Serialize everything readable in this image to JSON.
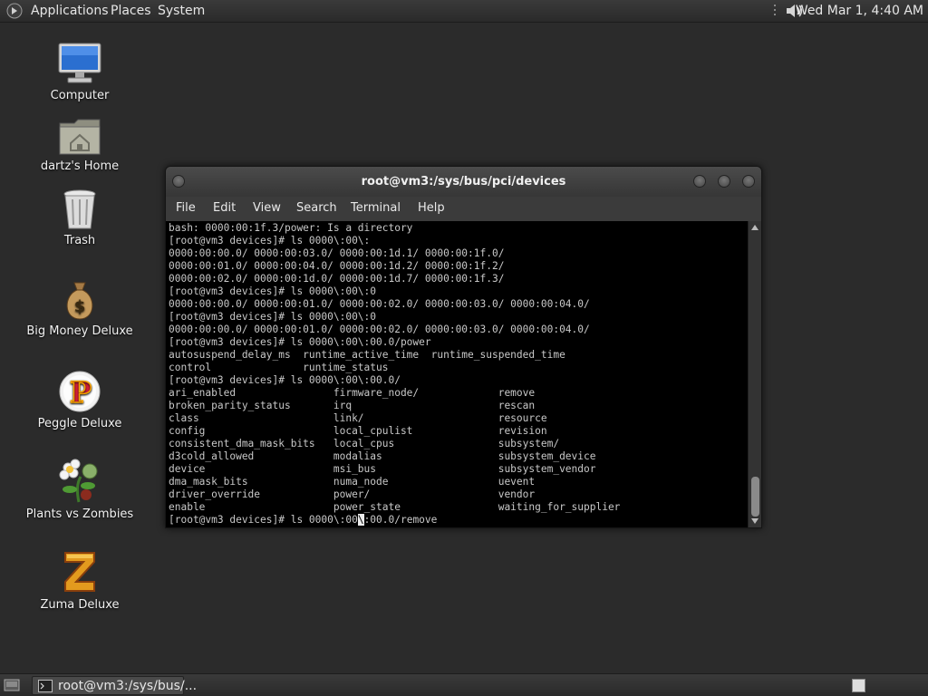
{
  "top_panel": {
    "menus": [
      "Applications",
      "Places",
      "System"
    ],
    "clock": "Wed Mar 1,  4:40 AM"
  },
  "desktop": {
    "icons": [
      {
        "label": "Computer",
        "icon": "computer-icon"
      },
      {
        "label": "dartz's Home",
        "icon": "home-folder-icon"
      },
      {
        "label": "Trash",
        "icon": "trash-icon"
      },
      {
        "label": "Big Money Deluxe",
        "icon": "money-bag-icon"
      },
      {
        "label": "Peggle Deluxe",
        "icon": "peggle-icon"
      },
      {
        "label": "Plants vs Zombies",
        "icon": "plants-vs-zombies-icon"
      },
      {
        "label": "Zuma Deluxe",
        "icon": "zuma-icon"
      }
    ]
  },
  "terminal": {
    "title": "root@vm3:/sys/bus/pci/devices",
    "menu": [
      "File",
      "Edit",
      "View",
      "Search",
      "Terminal",
      "Help"
    ],
    "lines": [
      "bash: 0000:00:1f.3/power: Is a directory",
      "[root@vm3 devices]# ls 0000\\:00\\:",
      "0000:00:00.0/ 0000:00:03.0/ 0000:00:1d.1/ 0000:00:1f.0/",
      "0000:00:01.0/ 0000:00:04.0/ 0000:00:1d.2/ 0000:00:1f.2/",
      "0000:00:02.0/ 0000:00:1d.0/ 0000:00:1d.7/ 0000:00:1f.3/",
      "[root@vm3 devices]# ls 0000\\:00\\:0",
      "0000:00:00.0/ 0000:00:01.0/ 0000:00:02.0/ 0000:00:03.0/ 0000:00:04.0/",
      "[root@vm3 devices]# ls 0000\\:00\\:0",
      "0000:00:00.0/ 0000:00:01.0/ 0000:00:02.0/ 0000:00:03.0/ 0000:00:04.0/",
      "[root@vm3 devices]# ls 0000\\:00\\:00.0/power",
      "autosuspend_delay_ms  runtime_active_time  runtime_suspended_time",
      "control               runtime_status",
      "[root@vm3 devices]# ls 0000\\:00\\:00.0/",
      "ari_enabled                firmware_node/             remove",
      "broken_parity_status       irq                        rescan",
      "class                      link/                      resource",
      "config                     local_cpulist              revision",
      "consistent_dma_mask_bits   local_cpus                 subsystem/",
      "d3cold_allowed             modalias                   subsystem_device",
      "device                     msi_bus                    subsystem_vendor",
      "dma_mask_bits              numa_node                  uevent",
      "driver_override            power/                     vendor",
      "enable                     power_state                waiting_for_supplier"
    ],
    "prompt_before_cursor": "[root@vm3 devices]# ls 0000\\:00",
    "prompt_cursor_char": "\\",
    "prompt_after_cursor": ":00.0/remove"
  },
  "taskbar": {
    "task_label": "root@vm3:/sys/bus/..."
  }
}
